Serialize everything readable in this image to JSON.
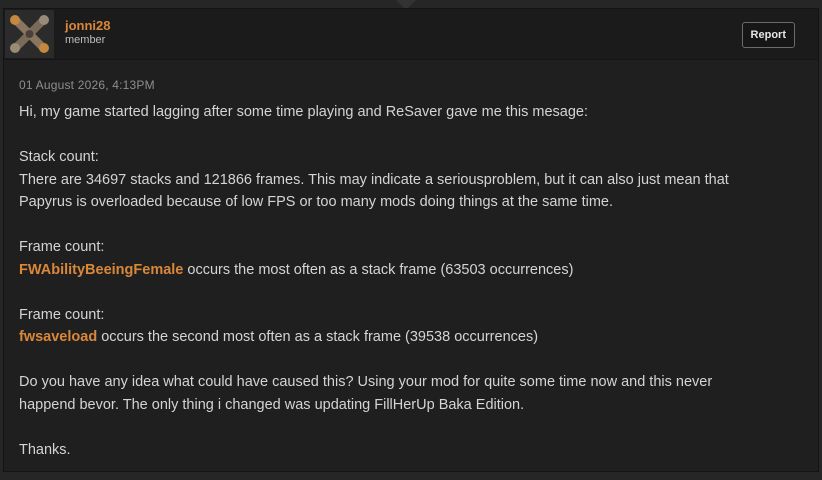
{
  "user": {
    "name": "jonni28",
    "title": "member"
  },
  "actions": {
    "report_label": "Report"
  },
  "post": {
    "timestamp": "01 August 2026, 4:13PM",
    "intro": "Hi, my game started lagging after some time playing and ReSaver gave me this mesage:",
    "stack_heading": "Stack count:",
    "stack_line1": "There are 34697 stacks and 121866 frames. This may indicate a seriousproblem, but it can also just mean that",
    "stack_line2": "Papyrus is overloaded because of low FPS or too many mods doing things at the same time.",
    "frame1_heading": "Frame count:",
    "frame1_name": "FWAbilityBeeingFemale",
    "frame1_rest": " occurs the most often as a stack frame (63503 occurrences)",
    "frame2_heading": "Frame count:",
    "frame2_name": "fwsaveload",
    "frame2_rest": " occurs the second most often as a stack frame (39538 occurrences)",
    "question_line1": "Do  you have any idea what could have caused this? Using your mod for quite some time now and this never",
    "question_line2": "happend bevor. The only thing i changed was updating FillHerUp Baka Edition.",
    "signoff": "Thanks."
  },
  "colors": {
    "accent": "#d9873a",
    "background": "#262626",
    "panel": "#1f1f1f"
  },
  "icons": {
    "avatar": "crossed-shapes-avatar-icon"
  }
}
